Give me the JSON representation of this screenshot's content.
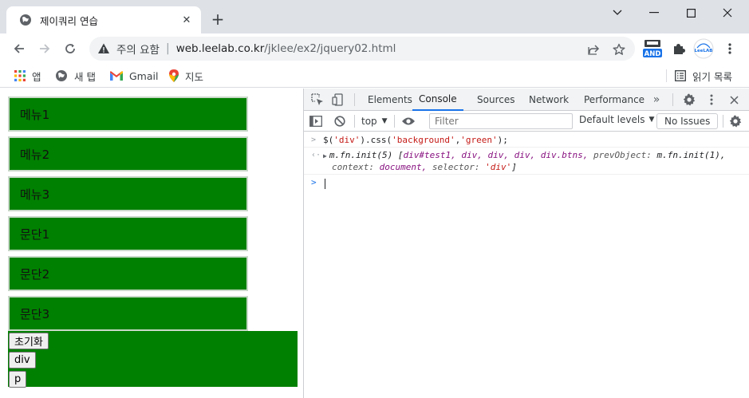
{
  "browser": {
    "tab": {
      "title": "제이쿼리 연습"
    },
    "omnibox": {
      "warning": "주의 요함",
      "host": "web.leelab.co.kr",
      "path": "/jklee/ex2/jquery02.html"
    },
    "extensions": {
      "and_label": "AND",
      "leelab_label": "LeeLAB"
    },
    "bookmarks": [
      {
        "label": "앱",
        "icon": "apps-grid-icon"
      },
      {
        "label": "새 탭",
        "icon": "globe-icon"
      },
      {
        "label": "Gmail",
        "icon": "gmail-icon"
      },
      {
        "label": "지도",
        "icon": "maps-pin-icon"
      }
    ],
    "reading_list": "읽기 목록"
  },
  "page": {
    "background_color": "#008000",
    "boxes": [
      "메뉴1",
      "메뉴2",
      "메뉴3",
      "문단1",
      "문단2",
      "문단3"
    ],
    "buttons": [
      "초기화",
      "div",
      "p"
    ]
  },
  "devtools": {
    "tabs": [
      "Elements",
      "Console",
      "Sources",
      "Network",
      "Performance"
    ],
    "active_tab": "Console",
    "context": "top",
    "filter_placeholder": "Filter",
    "levels": "Default levels",
    "issues": "No Issues",
    "console": {
      "command": {
        "prefix": "$(",
        "arg1": "'div'",
        "middle": ").css(",
        "arg2": "'background'",
        "comma": ",",
        "arg3": "'green'",
        "suffix": ");"
      },
      "result": {
        "head": "m.fn.init(5) [",
        "items": "div#test1, div, div, div, div.btns,",
        "k1": " prevObject:",
        "v1": " m.fn.init(1),",
        "k2": "context:",
        "v2": " document,",
        "k3": " selector:",
        "v3": " 'div'",
        "tail": "]"
      }
    }
  }
}
